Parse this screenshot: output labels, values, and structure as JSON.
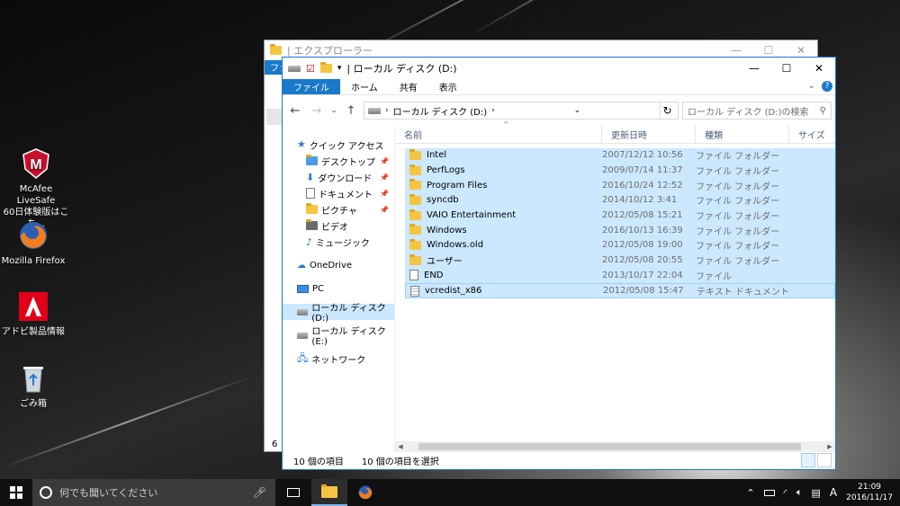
{
  "desktop": {
    "icons": [
      {
        "label1": "McAfee LiveSafe",
        "label2": "60日体験版はこち..."
      },
      {
        "label1": "Mozilla Firefox",
        "label2": ""
      },
      {
        "label1": "アドビ製品情報",
        "label2": ""
      },
      {
        "label1": "ごみ箱",
        "label2": ""
      }
    ]
  },
  "back_window": {
    "title": "| エクスプローラー",
    "ribbon_fragment": "ファ",
    "status_fragment": "6"
  },
  "explorer": {
    "title": "| ローカル ディスク (D:)",
    "ribbon_tabs": [
      "ファイル",
      "ホーム",
      "共有",
      "表示"
    ],
    "address": "ローカル ディスク (D:)",
    "search_placeholder": "ローカル ディスク (D:)の検索",
    "nav": {
      "quick_access": "クイック アクセス",
      "desktop": "デスクトップ",
      "downloads": "ダウンロード",
      "documents": "ドキュメント",
      "pictures": "ピクチャ",
      "videos": "ビデオ",
      "music": "ミュージック",
      "onedrive": "OneDrive",
      "pc": "PC",
      "drive_d": "ローカル ディスク (D:)",
      "drive_e": "ローカル ディスク (E:)",
      "network": "ネットワーク"
    },
    "columns": {
      "name": "名前",
      "date": "更新日時",
      "type": "種類",
      "size": "サイズ"
    },
    "files": [
      {
        "name": "Intel",
        "date": "2007/12/12 10:56",
        "type": "ファイル フォルダー",
        "kind": "folder"
      },
      {
        "name": "PerfLogs",
        "date": "2009/07/14 11:37",
        "type": "ファイル フォルダー",
        "kind": "folder"
      },
      {
        "name": "Program Files",
        "date": "2016/10/24 12:52",
        "type": "ファイル フォルダー",
        "kind": "folder"
      },
      {
        "name": "syncdb",
        "date": "2014/10/12 3:41",
        "type": "ファイル フォルダー",
        "kind": "folder"
      },
      {
        "name": "VAIO Entertainment",
        "date": "2012/05/08 15:21",
        "type": "ファイル フォルダー",
        "kind": "folder"
      },
      {
        "name": "Windows",
        "date": "2016/10/13 16:39",
        "type": "ファイル フォルダー",
        "kind": "folder"
      },
      {
        "name": "Windows.old",
        "date": "2012/05/08 19:00",
        "type": "ファイル フォルダー",
        "kind": "folder"
      },
      {
        "name": "ユーザー",
        "date": "2012/05/08 20:55",
        "type": "ファイル フォルダー",
        "kind": "folder"
      },
      {
        "name": "END",
        "date": "2013/10/17 22:04",
        "type": "ファイル",
        "kind": "file"
      },
      {
        "name": "vcredist_x86",
        "date": "2012/05/08 15:47",
        "type": "テキスト ドキュメント",
        "kind": "text"
      }
    ],
    "status": {
      "count": "10 個の項目",
      "selected": "10 個の項目を選択"
    }
  },
  "taskbar": {
    "search_placeholder": "何でも聞いてください",
    "ime": "A",
    "time": "21:09",
    "date": "2016/11/17"
  },
  "colors": {
    "accent": "#1979ca",
    "selection": "#cce8ff",
    "folder": "#f5c542"
  }
}
